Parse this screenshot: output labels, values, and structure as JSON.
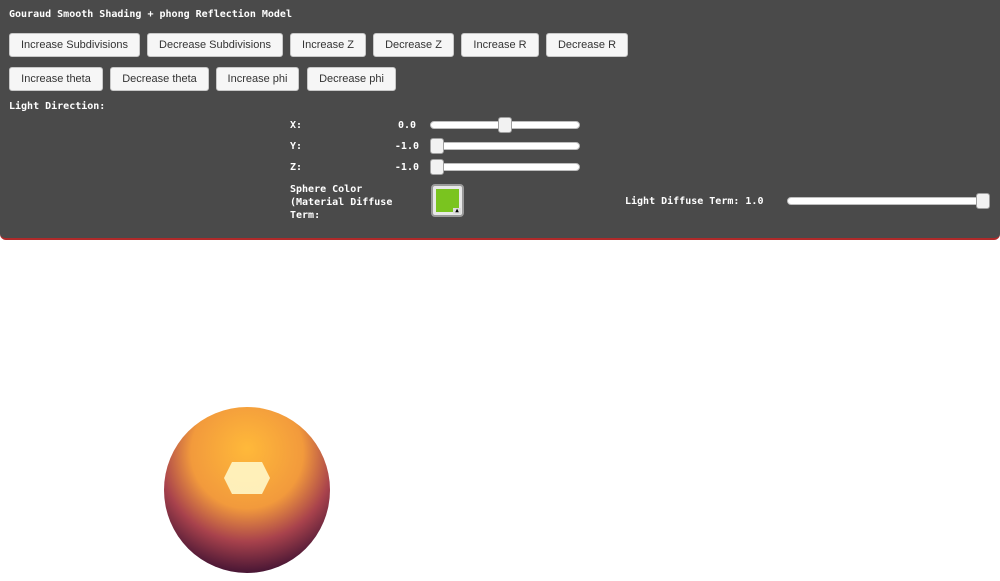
{
  "title": "Gouraud Smooth Shading + phong Reflection Model",
  "buttons_row1": [
    {
      "label": "Increase Subdivisions"
    },
    {
      "label": "Decrease Subdivisions"
    },
    {
      "label": "Increase Z"
    },
    {
      "label": "Decrease Z"
    },
    {
      "label": "Increase R"
    },
    {
      "label": "Decrease R"
    }
  ],
  "buttons_row2": [
    {
      "label": "Increase theta"
    },
    {
      "label": "Decrease theta"
    },
    {
      "label": "Increase phi"
    },
    {
      "label": "Decrease phi"
    }
  ],
  "light_direction": {
    "label": "Light Direction:",
    "x": {
      "label": "X:",
      "value": "0.0",
      "level": 0.5
    },
    "y": {
      "label": "Y:",
      "value": "-1.0",
      "level": 0.0
    },
    "z": {
      "label": "Z:",
      "value": "-1.0",
      "level": 0.0
    }
  },
  "sphere_color": {
    "label": "Sphere Color (Material Diffuse Term:",
    "color": "#7ac41f"
  },
  "light_diffuse": {
    "label": "Light Diffuse Term: 1.0",
    "level": 1.0
  },
  "colors": {
    "panel_bg": "#4a4a4a",
    "panel_border": "#b02a2a",
    "sphere_light": "#ffb93a",
    "sphere_dark": "#2e0a2e",
    "highlight": "#fff7c8"
  }
}
